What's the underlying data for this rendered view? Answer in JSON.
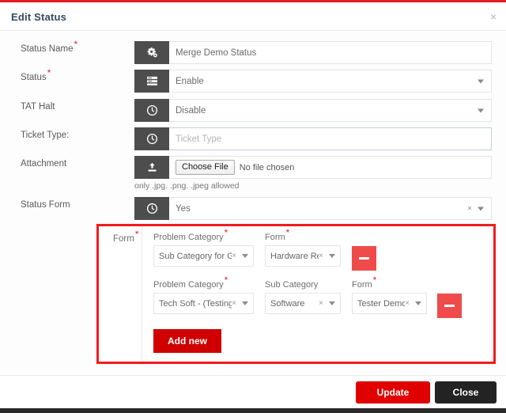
{
  "header": {
    "title": "Edit Status",
    "close_label": "×"
  },
  "fields": [
    {
      "label": "Status Name",
      "required": true,
      "icon": "cogs-icon",
      "value": "Merge Demo Status",
      "placeholder": "",
      "has_caret": false,
      "has_clear": false
    },
    {
      "label": "Status",
      "required": true,
      "icon": "list-icon",
      "value": "Enable",
      "placeholder": "",
      "has_caret": true,
      "has_clear": false
    },
    {
      "label": "TAT Halt",
      "required": false,
      "icon": "clock-icon",
      "value": "Disable",
      "placeholder": "",
      "has_caret": true,
      "has_clear": false
    },
    {
      "label": "Ticket Type:",
      "required": false,
      "icon": "clock-icon",
      "value": "",
      "placeholder": "Ticket Type",
      "has_caret": false,
      "has_clear": false
    },
    {
      "label": "Attachment",
      "required": false,
      "icon": "upload-icon",
      "file_button": "Choose File",
      "file_status": "No file chosen",
      "helper": "only .jpg. .png. .jpeg allowed"
    },
    {
      "label": "Status Form",
      "required": false,
      "icon": "clock-icon",
      "value": "Yes",
      "placeholder": "",
      "has_caret": true,
      "has_clear": true,
      "clear_label": "×"
    }
  ],
  "form_builder": {
    "label": "Form",
    "required": true,
    "rows": [
      {
        "selects": [
          {
            "label": "Problem Category",
            "required": true,
            "value": "Sub Category for Glob...",
            "clear_label": "×"
          },
          {
            "label": "Form",
            "required": true,
            "value": "Hardware Re...",
            "clear_label": "×"
          }
        ],
        "remove_label": "−"
      },
      {
        "selects": [
          {
            "label": "Problem Category",
            "required": true,
            "value": "Tech Soft - (Testing)",
            "clear_label": "×"
          },
          {
            "label": "Sub Category",
            "required": false,
            "value": "Software",
            "clear_label": "×"
          },
          {
            "label": "Form",
            "required": true,
            "value": "Tester Demo ...",
            "clear_label": "×"
          }
        ],
        "remove_label": "−"
      }
    ],
    "add_button": "Add new"
  },
  "footer": {
    "update_label": "Update",
    "close_label": "Close"
  },
  "colors": {
    "accent_red": "#e31b23",
    "highlight_red": "#f01c1c",
    "update_red": "#e00000",
    "add_red": "#d00000",
    "minus_red": "#ef4b4b",
    "close_dark": "#232323",
    "addon_gray": "#4d4d4d",
    "title_blue": "#34495e"
  }
}
